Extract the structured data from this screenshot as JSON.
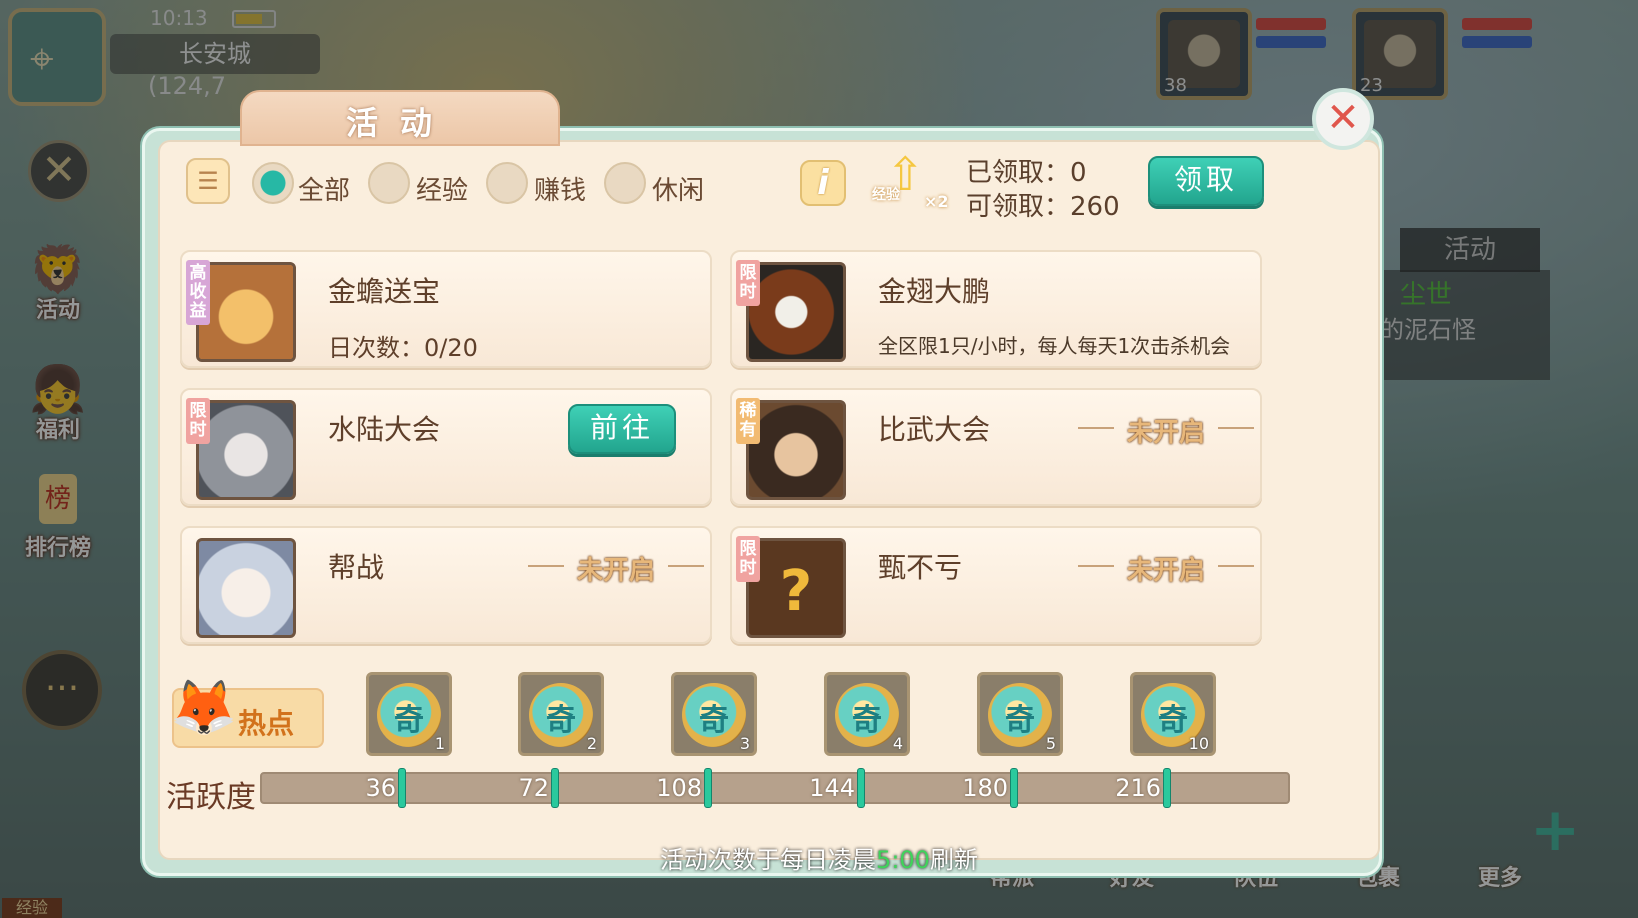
{
  "hud": {
    "time": "10:13",
    "city": "长安城",
    "coord": "(124,7"
  },
  "side": {
    "activity": "活动",
    "welfare": "福利",
    "rank_badge": "榜",
    "rank": "排行榜"
  },
  "party": [
    {
      "level": "38"
    },
    {
      "level": "23"
    }
  ],
  "right_panel": {
    "tab": "活动",
    "title": "尘世",
    "text": "的泥石怪"
  },
  "bottom_nav": [
    "帮派",
    "好友",
    "队伍",
    "包裹",
    "更多"
  ],
  "dialog": {
    "title": "活动",
    "filters": [
      {
        "label": "全部",
        "selected": true
      },
      {
        "label": "经验",
        "selected": false
      },
      {
        "label": "赚钱",
        "selected": false
      },
      {
        "label": "休闲",
        "selected": false
      }
    ],
    "info_label": "i",
    "exp_badge": {
      "text": "经验",
      "mult": "×2"
    },
    "claimed": "已领取：0",
    "claimable": "可领取：260",
    "claim_button": "领取",
    "activities": [
      {
        "name": "金蟾送宝",
        "tag": "高收益",
        "tag_color": "#d7a6d6",
        "sub": "日次数：0/20"
      },
      {
        "name": "金翅大鹏",
        "tag": "限时",
        "tag_color": "#f0a3a0",
        "desc": "全区限1只/小时，每人每天1次击杀机会"
      },
      {
        "name": "水陆大会",
        "tag": "限时",
        "tag_color": "#f0a3a0",
        "action": "前往"
      },
      {
        "name": "比武大会",
        "tag": "稀有",
        "tag_color": "#f2bb72",
        "status": "未开启"
      },
      {
        "name": "帮战",
        "status": "未开启"
      },
      {
        "name": "甄不亏",
        "tag": "限时",
        "tag_color": "#f0a3a0",
        "status": "未开启"
      }
    ],
    "hot_label": "热点",
    "rewards": [
      "1",
      "2",
      "3",
      "4",
      "5",
      "10"
    ],
    "activity_label": "活跃度",
    "activity_progress": 0,
    "milestones": [
      "36",
      "72",
      "108",
      "144",
      "180",
      "216"
    ],
    "footer_pre": "活动次数于每日凌晨",
    "footer_time": "5:00",
    "footer_post": "刷新"
  },
  "colors": {
    "accent": "#27b8a5",
    "title_brown": "#5e3f2a"
  }
}
